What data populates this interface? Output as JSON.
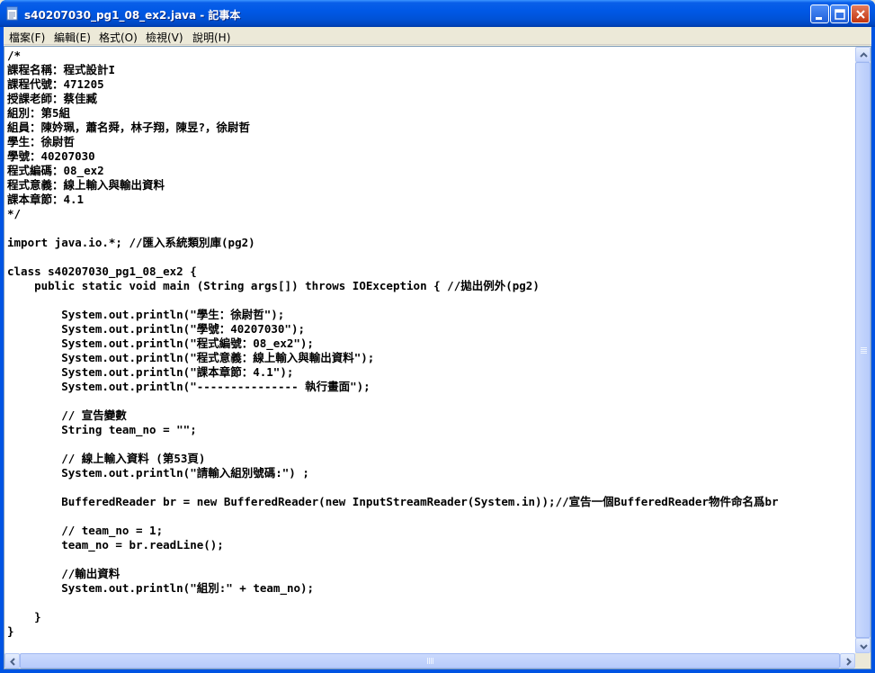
{
  "window": {
    "title": "s40207030_pg1_08_ex2.java - 記事本"
  },
  "menu": [
    {
      "label": "檔案(F)"
    },
    {
      "label": "編輯(E)"
    },
    {
      "label": "格式(O)"
    },
    {
      "label": "檢視(V)"
    },
    {
      "label": "說明(H)"
    }
  ],
  "editor": {
    "content": "/*\n課程名稱：程式設計I\n課程代號：471205\n授課老師：蔡佳臧\n組別：第5組\n組員：陳妗珮，蕭名舜，林子翔，陳昱?，徐尉哲\n學生：徐尉哲\n學號：40207030\n程式編碼：08_ex2\n程式意義：線上輸入與輸出資料\n課本章節：4.1\n*/\n\nimport java.io.*; //匯入系統類別庫(pg2)\n\nclass s40207030_pg1_08_ex2 {\n    public static void main (String args[]) throws IOException { //拋出例外(pg2)\n\n        System.out.println(\"學生：徐尉哲\");\n        System.out.println(\"學號：40207030\");\n        System.out.println(\"程式編號：08_ex2\");\n        System.out.println(\"程式意義：線上輸入與輸出資料\");\n        System.out.println(\"課本章節：4.1\");\n        System.out.println(\"--------------- 執行畫面\");\n\n        // 宣告變數\n        String team_no = \"\";\n\n        // 線上輸入資料 (第53頁)\n        System.out.println(\"請輸入組別號碼:\") ;\n\n        BufferedReader br = new BufferedReader(new InputStreamReader(System.in));//宣告一個BufferedReader物件命名爲br\n\n        // team_no = 1;\n        team_no = br.readLine();\n\n        //輸出資料\n        System.out.println(\"組別:\" + team_no);\n\n    }\n}"
  }
}
